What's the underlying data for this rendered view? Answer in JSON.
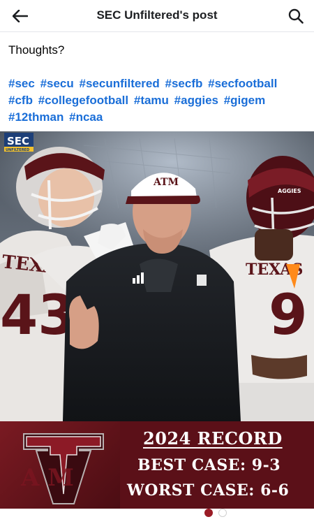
{
  "header": {
    "title": "SEC Unfiltered's post",
    "back_icon": "arrow-left-icon",
    "search_icon": "search-icon"
  },
  "post": {
    "text": "Thoughts?",
    "hashtags": [
      "#sec",
      "#secu",
      "#secunfiltered",
      "#secfb",
      "#secfootball",
      "#cfb",
      "#collegefootball",
      "#tamu",
      "#aggies",
      "#gigem",
      "#12thman",
      "#ncaa"
    ]
  },
  "image": {
    "watermark_top": "SEC",
    "watermark_bottom": "UNFILTERED",
    "jersey_left": "TEXAS A&M",
    "jersey_left_number": "43",
    "jersey_right": "TEXAS",
    "jersey_right_number": "9",
    "helmet_right_text": "AGGIES",
    "cap_logo": "ATM",
    "banner_logo": "ATM",
    "banner_logo_text": "A  M",
    "record_title": "2024 RECORD",
    "best_case": "BEST CASE: 9-3",
    "worst_case": "WORST CASE: 6-6"
  },
  "carousel": {
    "count": 2,
    "active": 2
  },
  "colors": {
    "maroon": "#5b1018",
    "hashtag": "#1a6ed8",
    "accent_dot": "#9a1c26"
  }
}
